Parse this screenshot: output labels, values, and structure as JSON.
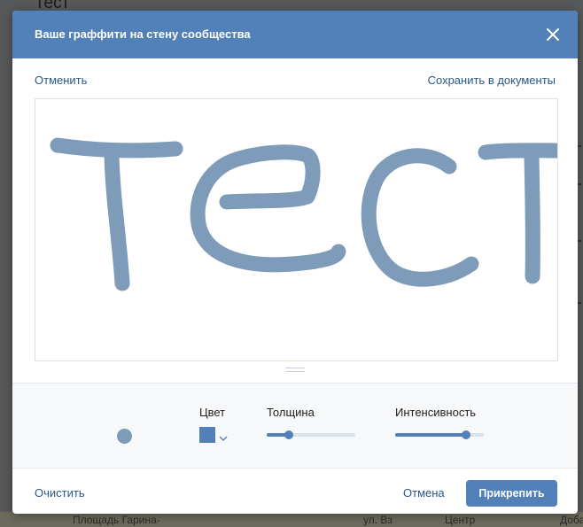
{
  "background": {
    "page_title": "Тест",
    "map_labels": [
      "Площадь Гарина-",
      "ул. Вз",
      "Центр",
      "Доба"
    ]
  },
  "dialog": {
    "title": "Ваше граффити на стену сообщества",
    "close_icon": "close-icon",
    "cancel_label": "Отменить",
    "save_to_docs_label": "Сохранить в документы"
  },
  "canvas": {
    "drawing_text": "Тест",
    "stroke_color": "#7e9bb9"
  },
  "controls": {
    "color_label": "Цвет",
    "thickness_label": "Толщина",
    "intensity_label": "Интенсивность",
    "selected_color": "#7e9bb9",
    "thickness_fraction": 0.25,
    "intensity_fraction": 0.8
  },
  "footer": {
    "clear_label": "Очистить",
    "cancel_label": "Отмена",
    "attach_label": "Прикрепить"
  },
  "colors": {
    "header": "#5181b8",
    "link": "#2a5885",
    "accent": "#5181b8"
  }
}
